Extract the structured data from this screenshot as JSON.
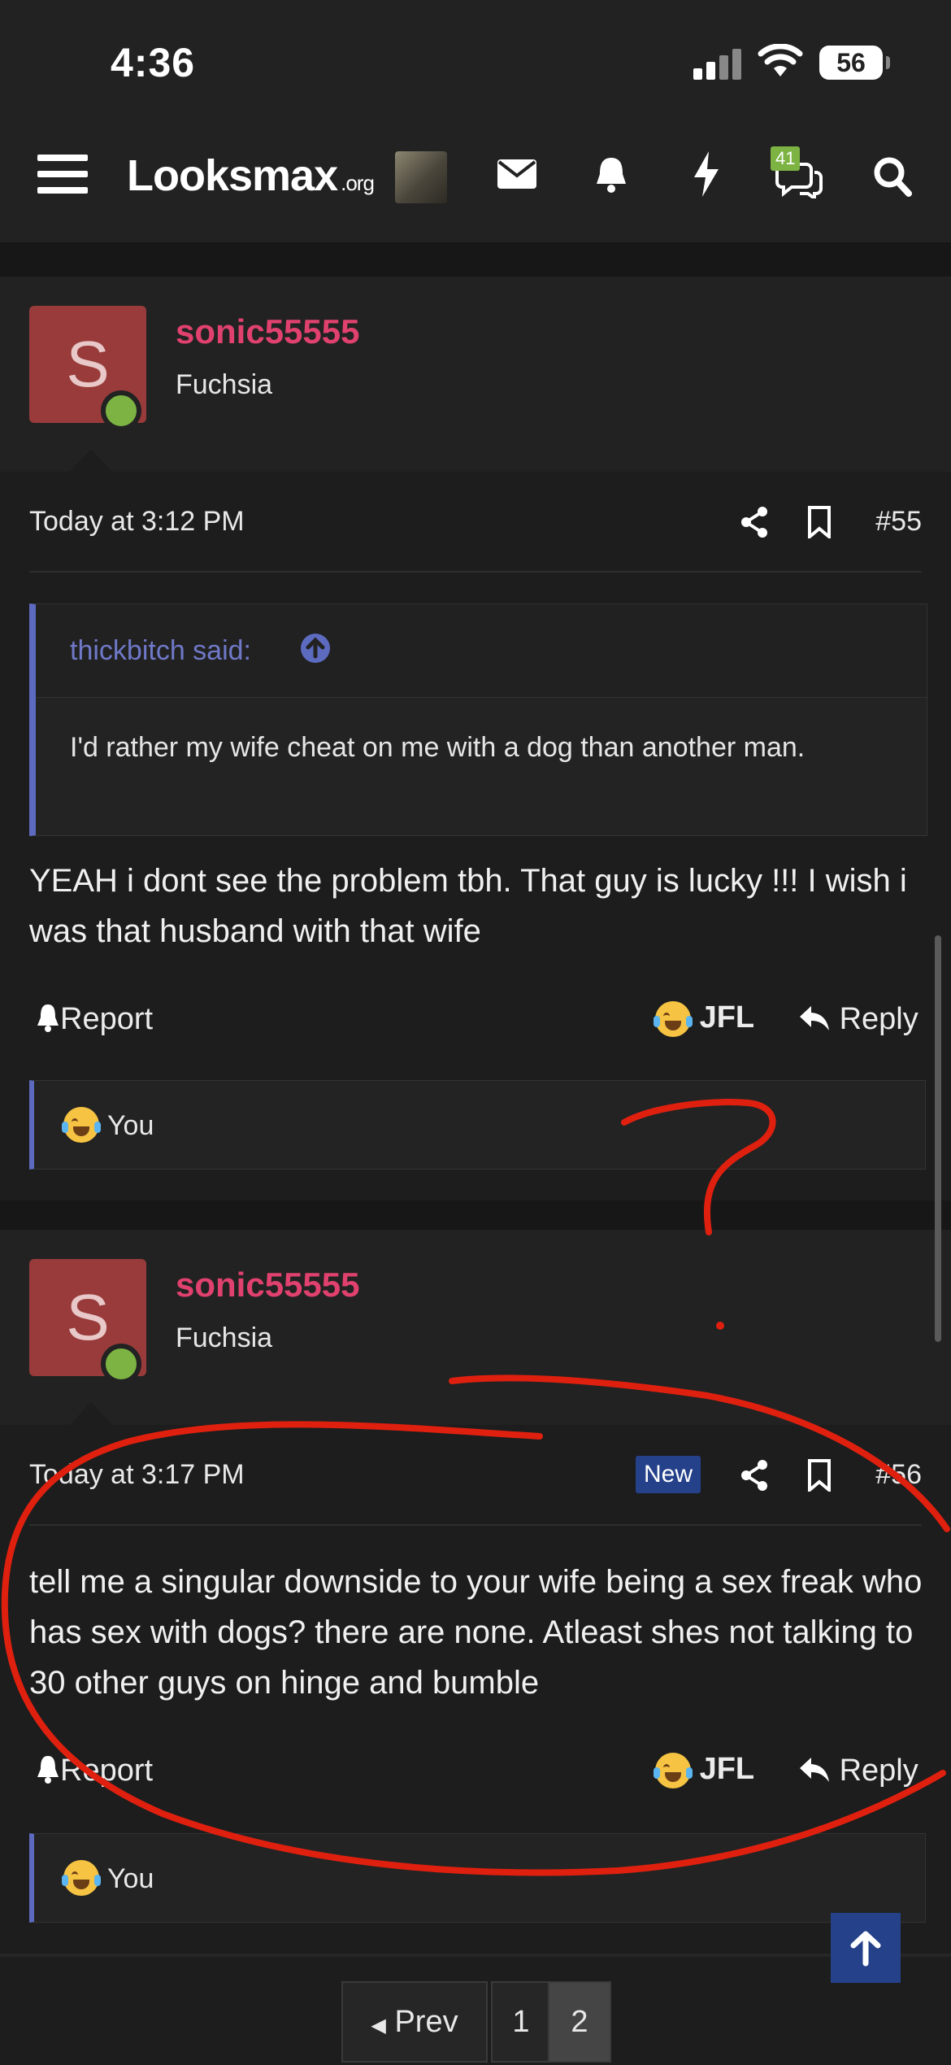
{
  "status_bar": {
    "time": "4:36",
    "battery": "56"
  },
  "navbar": {
    "logo_main": "Looksmax",
    "logo_suffix": ".org",
    "chat_count": "41"
  },
  "posts": [
    {
      "avatar_letter": "S",
      "username": "sonic55555",
      "user_title": "Fuchsia",
      "timestamp": "Today at 3:12 PM",
      "post_number": "#55",
      "quote": {
        "author": "thickbitch said:",
        "text": "I'd rather my wife cheat on me with a dog than another man."
      },
      "body": "YEAH i dont see the problem tbh. That guy is lucky !!! I wish i was that husband with that wife",
      "report_label": "Report",
      "reaction_label": "JFL",
      "reply_label": "Reply",
      "reacted_by": "You"
    },
    {
      "avatar_letter": "S",
      "username": "sonic55555",
      "user_title": "Fuchsia",
      "timestamp": "Today at 3:17 PM",
      "new_badge": "New",
      "post_number": "#56",
      "body": "tell me a singular downside to your wife being a sex freak who has sex with dogs? there are none. Atleast shes not talking to 30 other guys on hinge and bumble",
      "report_label": "Report",
      "reaction_label": "JFL",
      "reply_label": "Reply",
      "reacted_by": "You"
    }
  ],
  "pagination": {
    "prev_label": "Prev",
    "pages": [
      "1",
      "2"
    ],
    "current_page": "2"
  },
  "colors": {
    "accent": "#5c6bc0",
    "username": "#e0416e",
    "online": "#7cb342",
    "annotation": "#e0200f"
  }
}
